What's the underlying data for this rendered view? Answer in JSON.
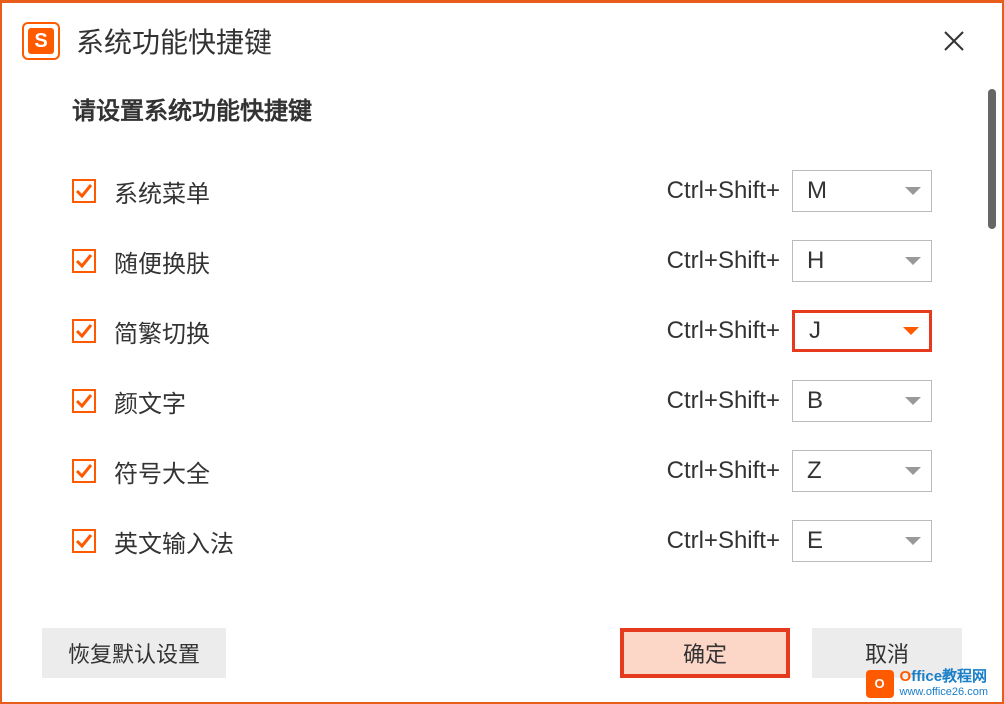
{
  "titlebar": {
    "title": "系统功能快捷键",
    "app_icon_letter": "S"
  },
  "subtitle": "请设置系统功能快捷键",
  "rows": [
    {
      "label": "系统菜单",
      "modifier": "Ctrl+Shift+",
      "key": "M",
      "checked": true,
      "highlight": false
    },
    {
      "label": "随便换肤",
      "modifier": "Ctrl+Shift+",
      "key": "H",
      "checked": true,
      "highlight": false
    },
    {
      "label": "简繁切换",
      "modifier": "Ctrl+Shift+",
      "key": "J",
      "checked": true,
      "highlight": true
    },
    {
      "label": "颜文字",
      "modifier": "Ctrl+Shift+",
      "key": "B",
      "checked": true,
      "highlight": false
    },
    {
      "label": "符号大全",
      "modifier": "Ctrl+Shift+",
      "key": "Z",
      "checked": true,
      "highlight": false
    },
    {
      "label": "英文输入法",
      "modifier": "Ctrl+Shift+",
      "key": "E",
      "checked": true,
      "highlight": false
    }
  ],
  "buttons": {
    "reset": "恢复默认设置",
    "ok": "确定",
    "cancel": "取消"
  },
  "watermark": {
    "icon_letter": "O",
    "title_o": "O",
    "title_rest": "ffice教程网",
    "url": "www.office26.com"
  }
}
